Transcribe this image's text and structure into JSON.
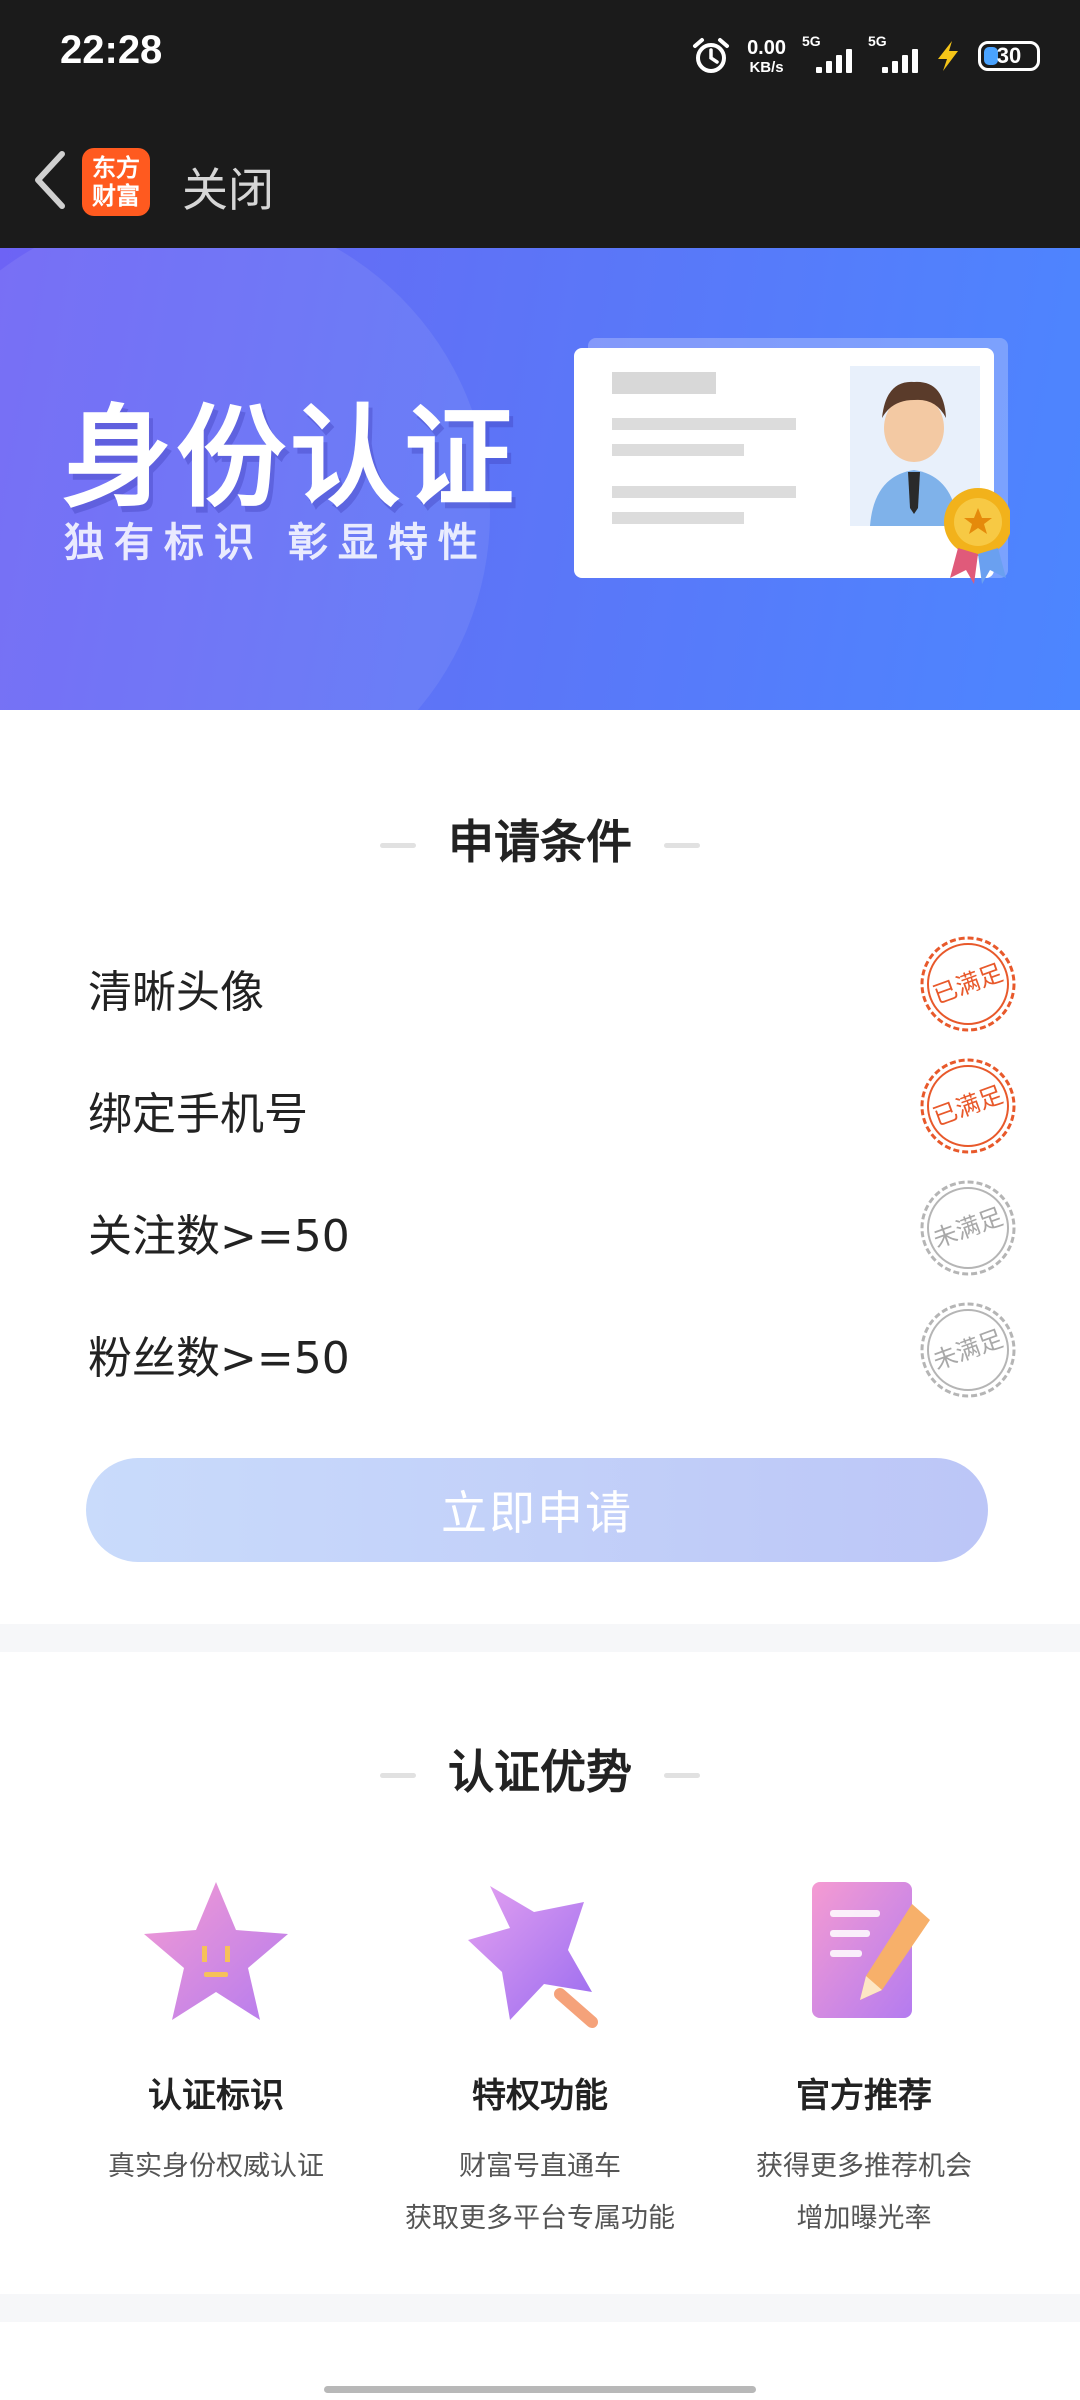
{
  "status": {
    "time": "22:28",
    "net_speed_value": "0.00",
    "net_speed_unit": "KB/s",
    "sim1": "5G",
    "sim2": "5G",
    "battery": "30"
  },
  "header": {
    "logo_line1": "东方",
    "logo_line2": "财富",
    "close_label": "关闭"
  },
  "banner": {
    "title": "身份认证",
    "subtitle": "独有标识 彰显特性"
  },
  "conditions": {
    "title": "申请条件",
    "items": [
      {
        "label": "清晰头像",
        "status": "已满足"
      },
      {
        "label": "绑定手机号",
        "status": "已满足"
      },
      {
        "label": "关注数>=50",
        "status": "未满足"
      },
      {
        "label": "粉丝数>=50",
        "status": "未满足"
      }
    ],
    "apply_label": "立即申请"
  },
  "advantages": {
    "title": "认证优势",
    "items": [
      {
        "title": "认证标识",
        "desc1": "真实身份权威认证",
        "desc2": ""
      },
      {
        "title": "特权功能",
        "desc1": "财富号直通车",
        "desc2": "获取更多平台专属功能"
      },
      {
        "title": "官方推荐",
        "desc1": "获得更多推荐机会",
        "desc2": "增加曝光率"
      }
    ]
  },
  "colors": {
    "met_stamp": "#e8592b",
    "unmet_stamp": "#b5b5b5",
    "banner_start": "#6d63f5",
    "banner_end": "#4c86ff"
  }
}
